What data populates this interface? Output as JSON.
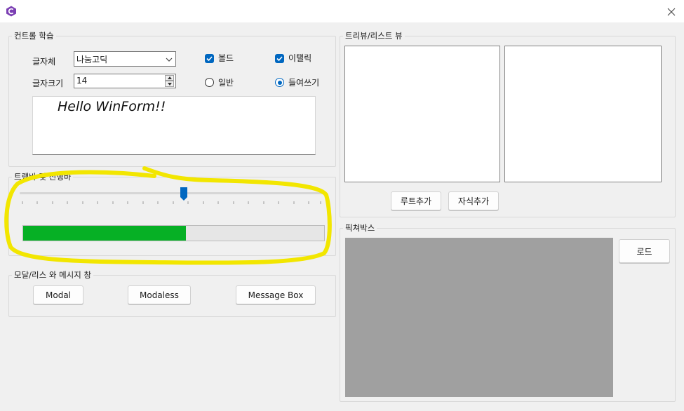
{
  "window": {
    "icon": "csharp-app-icon",
    "close_icon": "close-icon"
  },
  "controls_group": {
    "title": "컨트롤 학습",
    "font_label": "글자체",
    "font_value": "나눔고딕",
    "size_label": "글자크기",
    "size_value": "14",
    "bold_label": "볼드",
    "bold_checked": true,
    "italic_label": "이탤릭",
    "italic_checked": true,
    "normal_label": "일반",
    "underline_label": "들여쓰기",
    "selected_style": "들여쓰기",
    "preview_text": "Hello WinForm!!"
  },
  "trackbar_group": {
    "title": "트랙바 및 진행바",
    "trackbar_value": 0.54,
    "progress_value": 0.54,
    "progress_color": "#06b025",
    "highlight_color": "#f2e600"
  },
  "modal_group": {
    "title": "모달/리스 와 메시지 창",
    "modal_button": "Modal",
    "modaless_button": "Modaless",
    "messagebox_button": "Message Box"
  },
  "tree_group": {
    "title": "트리뷰/리스트 뷰",
    "add_root_button": "루트추가",
    "add_child_button": "자식추가"
  },
  "picture_group": {
    "title": "픽쳐박스",
    "load_button": "로드",
    "picture_color": "#a0a0a0"
  }
}
